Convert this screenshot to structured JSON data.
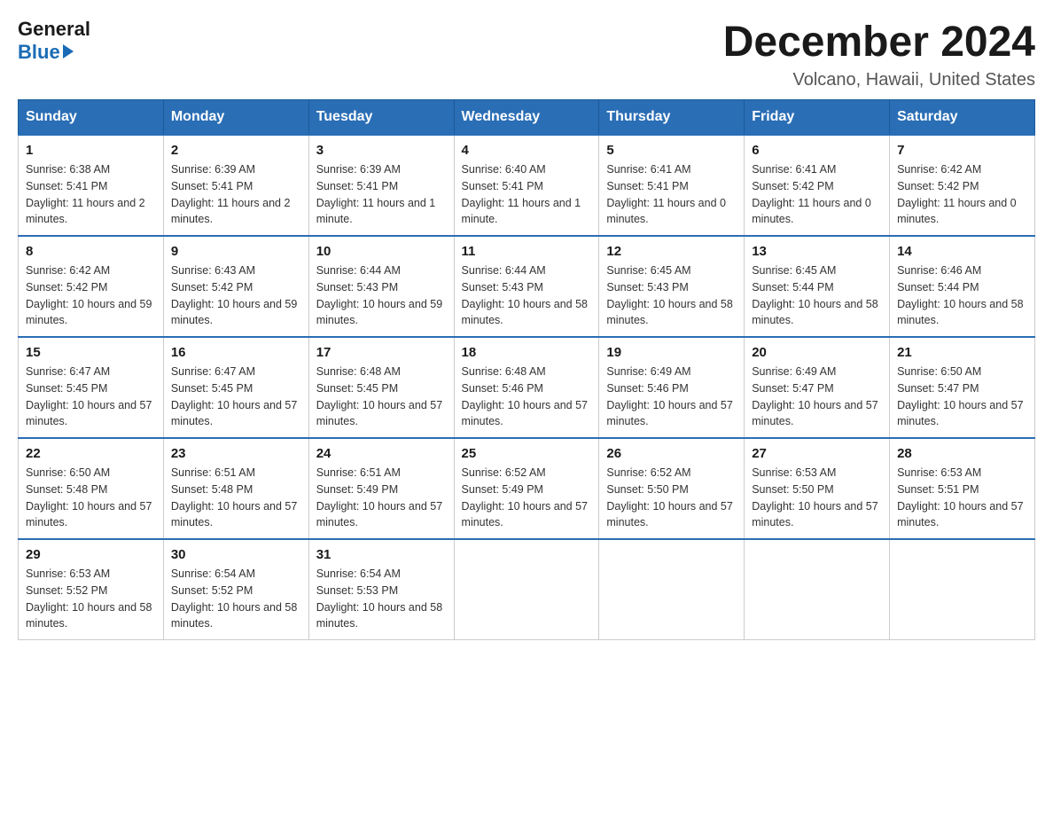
{
  "header": {
    "logo_general": "General",
    "logo_blue": "Blue",
    "title": "December 2024",
    "subtitle": "Volcano, Hawaii, United States"
  },
  "days_of_week": [
    "Sunday",
    "Monday",
    "Tuesday",
    "Wednesday",
    "Thursday",
    "Friday",
    "Saturday"
  ],
  "weeks": [
    [
      {
        "day": "1",
        "sunrise": "6:38 AM",
        "sunset": "5:41 PM",
        "daylight": "11 hours and 2 minutes."
      },
      {
        "day": "2",
        "sunrise": "6:39 AM",
        "sunset": "5:41 PM",
        "daylight": "11 hours and 2 minutes."
      },
      {
        "day": "3",
        "sunrise": "6:39 AM",
        "sunset": "5:41 PM",
        "daylight": "11 hours and 1 minute."
      },
      {
        "day": "4",
        "sunrise": "6:40 AM",
        "sunset": "5:41 PM",
        "daylight": "11 hours and 1 minute."
      },
      {
        "day": "5",
        "sunrise": "6:41 AM",
        "sunset": "5:41 PM",
        "daylight": "11 hours and 0 minutes."
      },
      {
        "day": "6",
        "sunrise": "6:41 AM",
        "sunset": "5:42 PM",
        "daylight": "11 hours and 0 minutes."
      },
      {
        "day": "7",
        "sunrise": "6:42 AM",
        "sunset": "5:42 PM",
        "daylight": "11 hours and 0 minutes."
      }
    ],
    [
      {
        "day": "8",
        "sunrise": "6:42 AM",
        "sunset": "5:42 PM",
        "daylight": "10 hours and 59 minutes."
      },
      {
        "day": "9",
        "sunrise": "6:43 AM",
        "sunset": "5:42 PM",
        "daylight": "10 hours and 59 minutes."
      },
      {
        "day": "10",
        "sunrise": "6:44 AM",
        "sunset": "5:43 PM",
        "daylight": "10 hours and 59 minutes."
      },
      {
        "day": "11",
        "sunrise": "6:44 AM",
        "sunset": "5:43 PM",
        "daylight": "10 hours and 58 minutes."
      },
      {
        "day": "12",
        "sunrise": "6:45 AM",
        "sunset": "5:43 PM",
        "daylight": "10 hours and 58 minutes."
      },
      {
        "day": "13",
        "sunrise": "6:45 AM",
        "sunset": "5:44 PM",
        "daylight": "10 hours and 58 minutes."
      },
      {
        "day": "14",
        "sunrise": "6:46 AM",
        "sunset": "5:44 PM",
        "daylight": "10 hours and 58 minutes."
      }
    ],
    [
      {
        "day": "15",
        "sunrise": "6:47 AM",
        "sunset": "5:45 PM",
        "daylight": "10 hours and 57 minutes."
      },
      {
        "day": "16",
        "sunrise": "6:47 AM",
        "sunset": "5:45 PM",
        "daylight": "10 hours and 57 minutes."
      },
      {
        "day": "17",
        "sunrise": "6:48 AM",
        "sunset": "5:45 PM",
        "daylight": "10 hours and 57 minutes."
      },
      {
        "day": "18",
        "sunrise": "6:48 AM",
        "sunset": "5:46 PM",
        "daylight": "10 hours and 57 minutes."
      },
      {
        "day": "19",
        "sunrise": "6:49 AM",
        "sunset": "5:46 PM",
        "daylight": "10 hours and 57 minutes."
      },
      {
        "day": "20",
        "sunrise": "6:49 AM",
        "sunset": "5:47 PM",
        "daylight": "10 hours and 57 minutes."
      },
      {
        "day": "21",
        "sunrise": "6:50 AM",
        "sunset": "5:47 PM",
        "daylight": "10 hours and 57 minutes."
      }
    ],
    [
      {
        "day": "22",
        "sunrise": "6:50 AM",
        "sunset": "5:48 PM",
        "daylight": "10 hours and 57 minutes."
      },
      {
        "day": "23",
        "sunrise": "6:51 AM",
        "sunset": "5:48 PM",
        "daylight": "10 hours and 57 minutes."
      },
      {
        "day": "24",
        "sunrise": "6:51 AM",
        "sunset": "5:49 PM",
        "daylight": "10 hours and 57 minutes."
      },
      {
        "day": "25",
        "sunrise": "6:52 AM",
        "sunset": "5:49 PM",
        "daylight": "10 hours and 57 minutes."
      },
      {
        "day": "26",
        "sunrise": "6:52 AM",
        "sunset": "5:50 PM",
        "daylight": "10 hours and 57 minutes."
      },
      {
        "day": "27",
        "sunrise": "6:53 AM",
        "sunset": "5:50 PM",
        "daylight": "10 hours and 57 minutes."
      },
      {
        "day": "28",
        "sunrise": "6:53 AM",
        "sunset": "5:51 PM",
        "daylight": "10 hours and 57 minutes."
      }
    ],
    [
      {
        "day": "29",
        "sunrise": "6:53 AM",
        "sunset": "5:52 PM",
        "daylight": "10 hours and 58 minutes."
      },
      {
        "day": "30",
        "sunrise": "6:54 AM",
        "sunset": "5:52 PM",
        "daylight": "10 hours and 58 minutes."
      },
      {
        "day": "31",
        "sunrise": "6:54 AM",
        "sunset": "5:53 PM",
        "daylight": "10 hours and 58 minutes."
      },
      null,
      null,
      null,
      null
    ]
  ],
  "labels": {
    "sunrise": "Sunrise:",
    "sunset": "Sunset:",
    "daylight": "Daylight:"
  }
}
